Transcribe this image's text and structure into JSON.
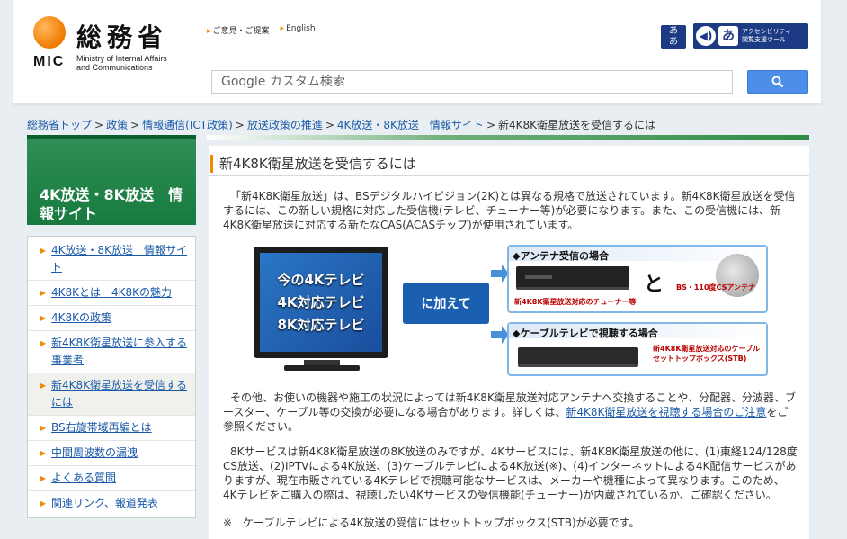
{
  "header": {
    "logo_jp": "総務省",
    "logo_abbr": "MIC",
    "logo_en_line1": "Ministry of Internal Affairs",
    "logo_en_line2": "and Communications",
    "link_opinion": "ご意見・ご提案",
    "link_english": "English",
    "acc_icon1_text": "あ\nあ",
    "acc_text": "アクセシビリティ\n閲覧支援ツール",
    "search_placeholder": "Google カスタム検索"
  },
  "breadcrumb": [
    "総務省トップ",
    "政策",
    "情報通信(ICT政策)",
    "放送政策の推進",
    "4K放送・8K放送　情報サイト"
  ],
  "breadcrumb_current": "新4K8K衛星放送を受信するには",
  "sidebar": {
    "title": "4K放送・8K放送　情報サイト",
    "items": [
      "4K放送・8K放送　情報サイト",
      "4K8Kとは　4K8Kの魅力",
      "4K8Kの政策",
      "新4K8K衛星放送に参入する事業者",
      "新4K8K衛星放送を受信するには",
      "BS右旋帯域再編とは",
      "中間周波数の漏洩",
      "よくある質問",
      "関連リンク、報道発表"
    ]
  },
  "main": {
    "title": "新4K8K衛星放送を受信するには",
    "para1": "「新4K8K衛星放送」は、BSデジタルハイビジョン(2K)とは異なる規格で放送されています。新4K8K衛星放送を受信するには、この新しい規格に対応した受信機(テレビ、チューナー等)が必要になります。また、この受信機には、新4K8K衛星放送に対応する新たなCAS(ACASチップ)が使用されています。",
    "para2_before": "その他、お使いの機器や施工の状況によっては新4K8K衛星放送対応アンテナへ交換することや、分配器、分波器、ブースター、ケーブル等の交換が必要になる場合があります。詳しくは、",
    "para2_link": "新4K8K衛星放送を視聴する場合のご注意",
    "para2_after": "をご参照ください。",
    "para3": "8Kサービスは新4K8K衛星放送の8K放送のみですが、4Kサービスには、新4K8K衛星放送の他に、(1)東経124/128度CS放送、(2)IPTVによる4K放送、(3)ケーブルテレビによる4K放送(※)、(4)インターネットによる4K配信サービスがありますが、現在市販されている4Kテレビで視聴可能なサービスは、メーカーや機種によって異なります。このため、4Kテレビをご購入の際は、視聴したい4Kサービスの受信機能(チューナー)が内蔵されているか、ご確認ください。",
    "para4": "※　ケーブルテレビによる4K放送の受信にはセットトップボックス(STB)が必要です。"
  },
  "diagram": {
    "tv_line1": "今の4Kテレビ",
    "tv_line2": "4K対応テレビ",
    "tv_line3": "8K対応テレビ",
    "kuwaete": "に加えて",
    "antenna_head": "◆アンテナ受信の場合",
    "tuner_label": "新4K8K衛星放送対応のチューナー等",
    "to": "と",
    "dish_label": "BS・110度CSアンテナ",
    "cable_head": "◆ケーブルテレビで視聴する場合",
    "stb_label": "新4K8K衛星放送対応のケーブルセットトップボックス(STB)"
  }
}
